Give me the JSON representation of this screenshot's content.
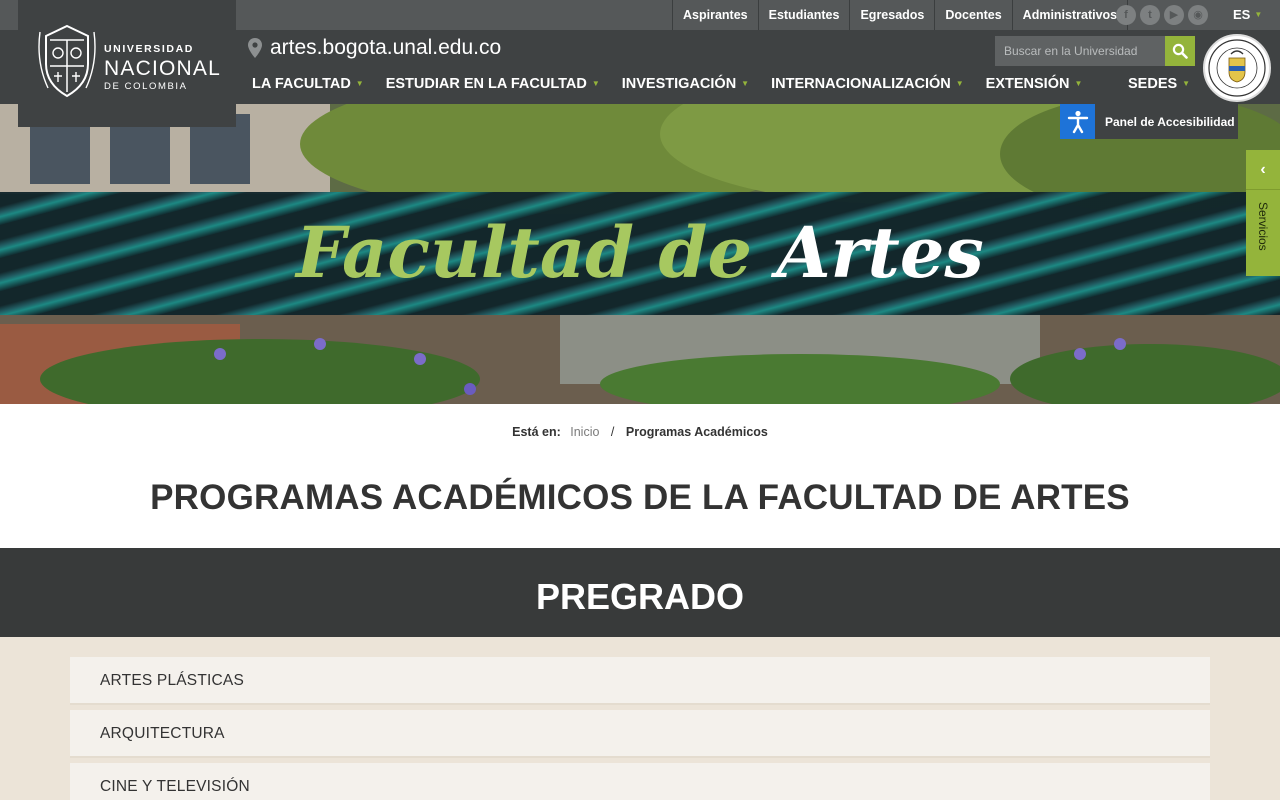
{
  "header": {
    "logo": {
      "line1": "UNIVERSIDAD",
      "line2": "NACIONAL",
      "line3": "DE COLOMBIA"
    },
    "audiences": [
      "Aspirantes",
      "Estudiantes",
      "Egresados",
      "Docentes",
      "Administrativos"
    ],
    "socials": [
      {
        "icon": "facebook-icon",
        "glyph": "f"
      },
      {
        "icon": "twitter-icon",
        "glyph": "t"
      },
      {
        "icon": "youtube-icon",
        "glyph": "▶"
      },
      {
        "icon": "rss-icon",
        "glyph": "◉"
      }
    ],
    "language": "ES",
    "site_url": "artes.bogota.unal.edu.co",
    "search": {
      "placeholder": "Buscar en la Universidad"
    },
    "nav": [
      "LA FACULTAD",
      "ESTUDIAR EN LA FACULTAD",
      "INVESTIGACIÓN",
      "INTERNACIONALIZACIÓN",
      "EXTENSIÓN"
    ],
    "sedes": "SEDES"
  },
  "hero": {
    "title_part1": "Facultad de",
    "title_part2": "Artes"
  },
  "accessibility": {
    "label": "Panel de Accesibilidad"
  },
  "servicios": {
    "label": "Servicios"
  },
  "breadcrumb": {
    "label": "Está en:",
    "home": "Inicio",
    "separator": "/",
    "current": "Programas Académicos"
  },
  "page_title": "PROGRAMAS ACADÉMICOS DE LA FACULTAD DE ARTES",
  "pregrado": {
    "heading": "PREGRADO",
    "programs": [
      "ARTES PLÁSTICAS",
      "ARQUITECTURA",
      "CINE Y TELEVISIÓN"
    ]
  },
  "colors": {
    "header_bg": "#3f4243",
    "topbar_bg": "#555859",
    "accent_green": "#94b43b",
    "title_green": "#a7c860",
    "access_blue": "#1e73d8",
    "section_dark": "#383a3a",
    "program_area": "#ece4d8"
  }
}
